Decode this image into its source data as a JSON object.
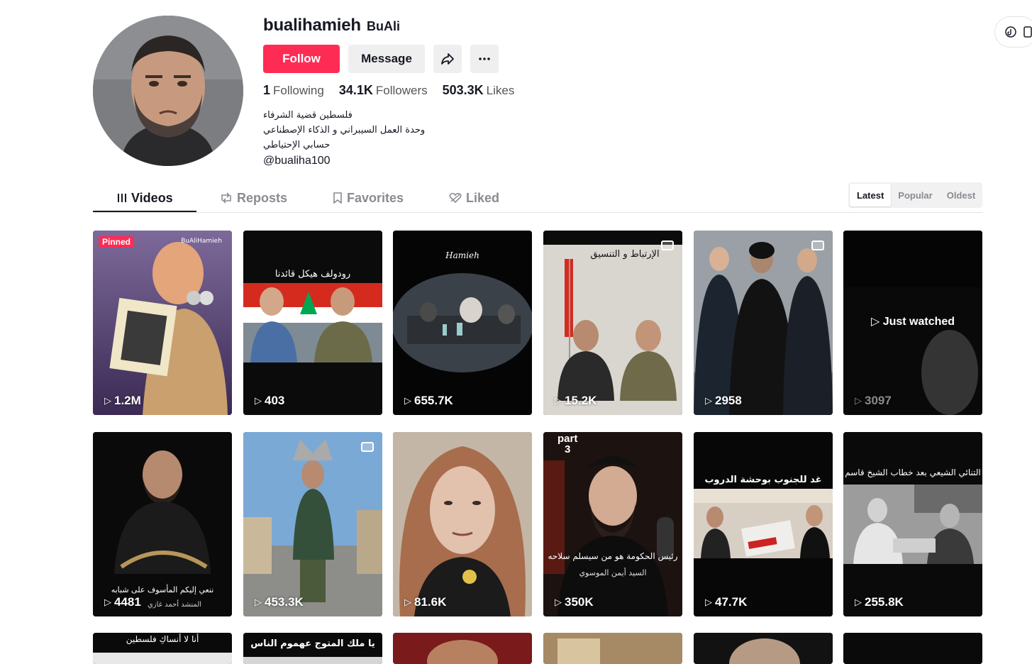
{
  "profile": {
    "username": "bualihamieh",
    "nickname": "BuAli",
    "follow_label": "Follow",
    "message_label": "Message",
    "stats": [
      {
        "value": "1",
        "label": "Following"
      },
      {
        "value": "34.1K",
        "label": "Followers"
      },
      {
        "value": "503.3K",
        "label": "Likes"
      }
    ],
    "bio_lines": [
      "فلسطين قضية الشرفاء",
      "وحدة العمل السيبراني و الذكاء الإصطناعي",
      "حسابي الإحتياطي",
      "@bualiha100"
    ],
    "colors": {
      "accent": "#fe2c55",
      "button_gray": "#efeff0",
      "text": "#161823"
    }
  },
  "tabs": [
    {
      "label": "Videos",
      "icon": "grid-icon"
    },
    {
      "label": "Reposts",
      "icon": "repost-icon"
    },
    {
      "label": "Favorites",
      "icon": "bookmark-icon"
    },
    {
      "label": "Liked",
      "icon": "heart-icon"
    }
  ],
  "sort": [
    "Latest",
    "Popular",
    "Oldest"
  ],
  "videos": [
    {
      "views": "1.2M",
      "badge": "Pinned",
      "watermark": "BuAliHamieh"
    },
    {
      "views": "403",
      "caption": "رودولف هيكل قائدنا"
    },
    {
      "views": "655.7K",
      "watermark": "Hamieh"
    },
    {
      "views": "15.2K",
      "caption": "الإرتباط و التنسيق"
    },
    {
      "views": "2958"
    },
    {
      "views": "3097",
      "overlay": "Just watched"
    },
    {
      "views": "4481",
      "caption": "ننعي إليكم المأسوف على شبابه",
      "caption2": "المنشد أحمد غازي"
    },
    {
      "views": "453.3K"
    },
    {
      "views": "81.6K"
    },
    {
      "views": "350K",
      "part": "part",
      "part_num": "3",
      "caption": "رئيس الحكومة هو من سيسلم سلاحه",
      "caption2": "السيد أيمن الموسوي"
    },
    {
      "views": "47.7K",
      "caption": "غد للجنوب بوحشة الدروب"
    },
    {
      "views": "255.8K",
      "caption": "التنائي الشيعي بعد خطاب الشيخ قاسم"
    },
    {
      "caption": "أنا لا أنساكِ فلسطين"
    },
    {
      "caption": "يا ملك المتوج عهموم الناس"
    },
    {},
    {},
    {},
    {}
  ]
}
